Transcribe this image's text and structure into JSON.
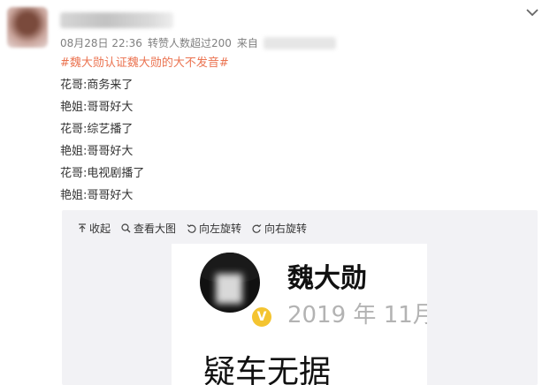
{
  "post": {
    "meta": {
      "date": "08月28日 22:36",
      "reposts": "转赞人数超过200",
      "source_prefix": "来自"
    },
    "hashtag": "#魏大勋认证魏大勋的大不发音#",
    "lines": [
      "花哥:商务来了",
      "艳姐:哥哥好大",
      "花哥:综艺播了",
      "艳姐:哥哥好大",
      "花哥:电视剧播了",
      "艳姐:哥哥好大"
    ]
  },
  "toolbar": {
    "collapse": "收起",
    "view_large": "查看大图",
    "rotate_left": "向左旋转",
    "rotate_right": "向右旋转"
  },
  "embedded": {
    "name": "魏大勋",
    "date": "2019 年 11月",
    "caption": "疑车无据",
    "badge": "V"
  },
  "colors": {
    "hashtag": "#eb7350",
    "text": "#333333",
    "meta": "#808080",
    "media_bg": "#f2f2f5",
    "badge": "#f4c430"
  },
  "icons": [
    "chevron-down-icon",
    "collapse-icon",
    "search-icon",
    "rotate-left-icon",
    "rotate-right-icon"
  ]
}
